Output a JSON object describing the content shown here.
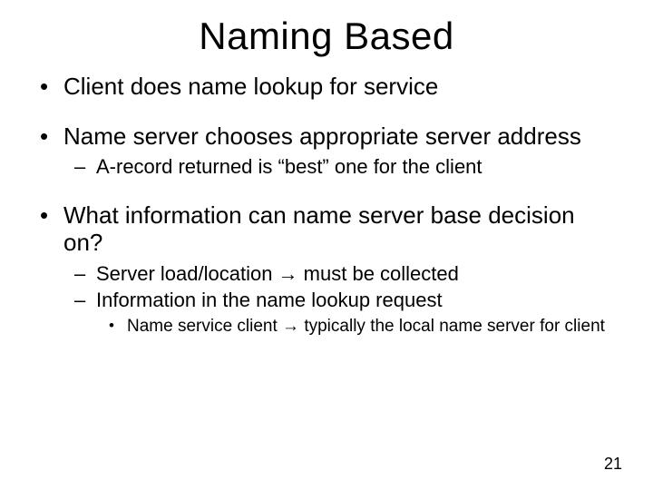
{
  "title": "Naming Based",
  "bullets": [
    {
      "text": "Client does name lookup for service"
    },
    {
      "text": "Name server chooses appropriate server address",
      "children": [
        {
          "text": "A-record returned is “best” one for the client"
        }
      ]
    },
    {
      "text": "What information can name server base decision on?",
      "children": [
        {
          "text": "Server load/location → must be collected"
        },
        {
          "text": "Information in the name lookup request",
          "children": [
            {
              "text": "Name service client → typically the local name server for client"
            }
          ]
        }
      ]
    }
  ],
  "page_number": "21"
}
